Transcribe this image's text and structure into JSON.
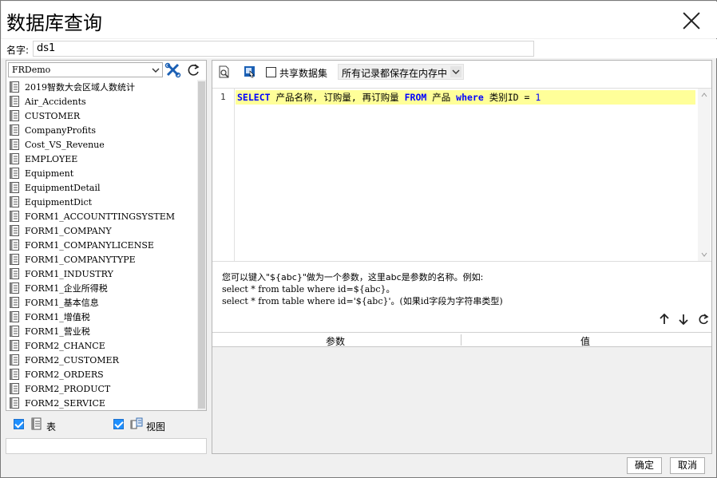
{
  "window": {
    "title": "数据库查询"
  },
  "name_field": {
    "label": "名字:",
    "value": "ds1"
  },
  "connection": {
    "selected": "FRDemo"
  },
  "tables": [
    "2019智数大会区域人数统计",
    "Air_Accidents",
    "CUSTOMER",
    "CompanyProfits",
    "Cost_VS_Revenue",
    "EMPLOYEE",
    "Equipment",
    "EquipmentDetail",
    "EquipmentDict",
    "FORM1_ACCOUNTTINGSYSTEM",
    "FORM1_COMPANY",
    "FORM1_COMPANYLICENSE",
    "FORM1_COMPANYTYPE",
    "FORM1_INDUSTRY",
    "FORM1_企业所得税",
    "FORM1_基本信息",
    "FORM1_增值税",
    "FORM1_营业税",
    "FORM2_CHANCE",
    "FORM2_CUSTOMER",
    "FORM2_ORDERS",
    "FORM2_PRODUCT",
    "FORM2_SERVICE"
  ],
  "filters": {
    "table_label": "表",
    "view_label": "视图"
  },
  "toolbar": {
    "share_label": "共享数据集",
    "memory_option": "所有记录都保存在内存中"
  },
  "editor": {
    "line_number": "1",
    "tokens": {
      "select": "SELECT",
      "fields": " 产品名称, 订购量, 再订购量 ",
      "from": "FROM",
      "table": " 产品 ",
      "where": "where",
      "cond": " 类别ID = ",
      "value": "1"
    }
  },
  "hint": {
    "line1": "您可以键入\"${abc}\"做为一个参数，这里abc是参数的名称。例如:",
    "line2": "select * from table where id=${abc}。",
    "line3": "select * from table where id='${abc}'。(如果id字段为字符串类型)"
  },
  "params_table": {
    "col_param": "参数",
    "col_value": "值"
  },
  "buttons": {
    "ok": "确定",
    "cancel": "取消"
  }
}
